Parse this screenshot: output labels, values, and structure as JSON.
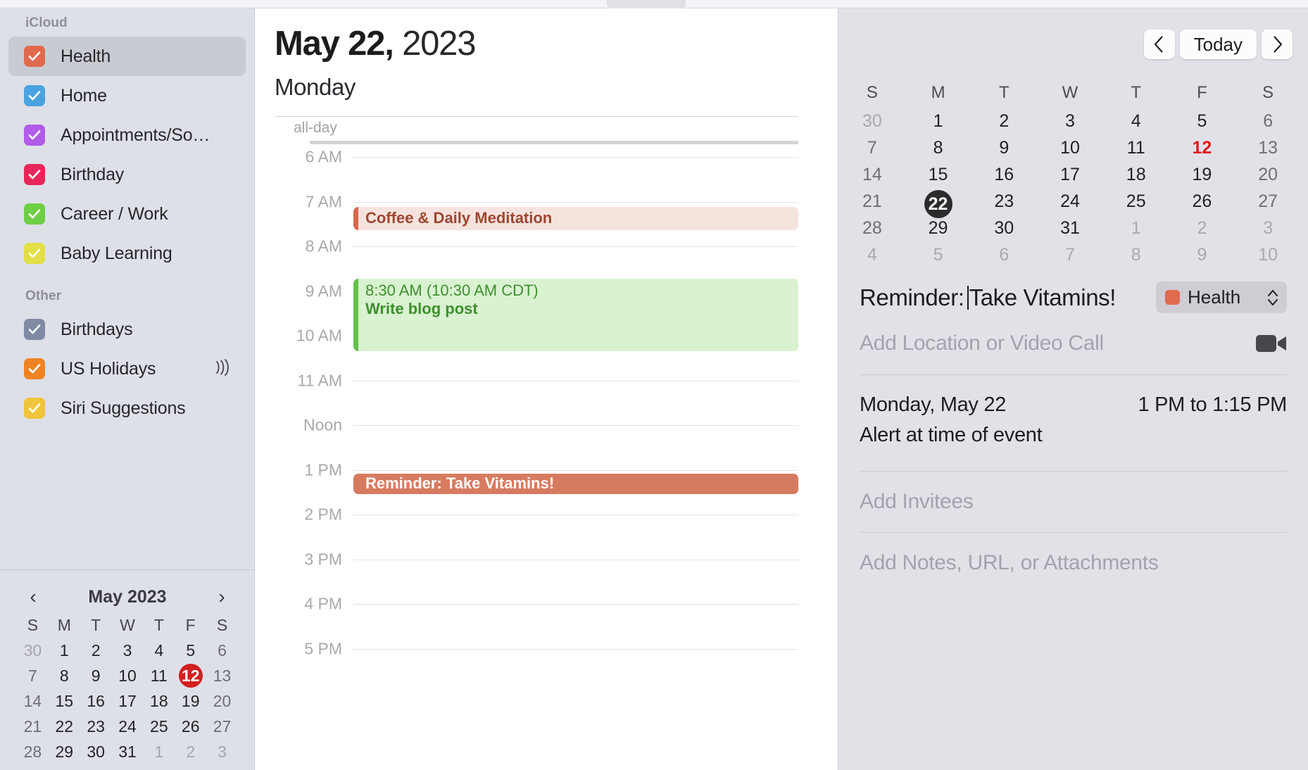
{
  "toolbar": {
    "pill_label": ""
  },
  "sidebar": {
    "sections": [
      {
        "title": "iCloud",
        "items": [
          {
            "label": "Health",
            "color": "#e06a4e",
            "checked": true,
            "selected": true,
            "broadcast": false
          },
          {
            "label": "Home",
            "color": "#4aa3e0",
            "checked": true,
            "selected": false,
            "broadcast": false
          },
          {
            "label": "Appointments/So…",
            "color": "#b05ce8",
            "checked": true,
            "selected": false,
            "broadcast": false
          },
          {
            "label": "Birthday",
            "color": "#e8265a",
            "checked": true,
            "selected": false,
            "broadcast": false
          },
          {
            "label": "Career / Work",
            "color": "#6ece45",
            "checked": true,
            "selected": false,
            "broadcast": false
          },
          {
            "label": "Baby Learning",
            "color": "#e2e046",
            "checked": true,
            "selected": false,
            "broadcast": false
          }
        ]
      },
      {
        "title": "Other",
        "items": [
          {
            "label": "Birthdays",
            "color": "#7f8aa3",
            "checked": true,
            "selected": false,
            "broadcast": false
          },
          {
            "label": "US Holidays",
            "color": "#ef8425",
            "checked": true,
            "selected": false,
            "broadcast": true
          },
          {
            "label": "Siri Suggestions",
            "color": "#f0c43c",
            "checked": true,
            "selected": false,
            "broadcast": false
          }
        ]
      }
    ],
    "mini_calendar": {
      "title": "May 2023",
      "prev_icon": "chevron-left-icon",
      "next_icon": "chevron-right-icon",
      "dow": [
        "S",
        "M",
        "T",
        "W",
        "T",
        "F",
        "S"
      ],
      "weeks": [
        [
          {
            "d": "30",
            "dim": true
          },
          {
            "d": "1"
          },
          {
            "d": "2"
          },
          {
            "d": "3"
          },
          {
            "d": "4"
          },
          {
            "d": "5"
          },
          {
            "d": "6"
          }
        ],
        [
          {
            "d": "7"
          },
          {
            "d": "8"
          },
          {
            "d": "9"
          },
          {
            "d": "10"
          },
          {
            "d": "11"
          },
          {
            "d": "12",
            "today": true
          },
          {
            "d": "13"
          }
        ],
        [
          {
            "d": "14"
          },
          {
            "d": "15"
          },
          {
            "d": "16"
          },
          {
            "d": "17"
          },
          {
            "d": "18"
          },
          {
            "d": "19"
          },
          {
            "d": "20"
          }
        ],
        [
          {
            "d": "21"
          },
          {
            "d": "22"
          },
          {
            "d": "23"
          },
          {
            "d": "24"
          },
          {
            "d": "25"
          },
          {
            "d": "26"
          },
          {
            "d": "27"
          }
        ],
        [
          {
            "d": "28"
          },
          {
            "d": "29"
          },
          {
            "d": "30"
          },
          {
            "d": "31"
          },
          {
            "d": "1",
            "dim": true
          },
          {
            "d": "2",
            "dim": true
          },
          {
            "d": "3",
            "dim": true
          }
        ]
      ]
    }
  },
  "dayview": {
    "month_day": "May 22,",
    "year": "2023",
    "weekday": "Monday",
    "allday_label": "all-day",
    "hours": [
      "6 AM",
      "7 AM",
      "8 AM",
      "9 AM",
      "10 AM",
      "11 AM",
      "Noon",
      "1 PM",
      "2 PM",
      "3 PM",
      "4 PM",
      "5 PM"
    ],
    "events": [
      {
        "title": "Coffee & Daily Meditation",
        "time": "",
        "start_hour_index": 1.12,
        "duration_hours": 0.52,
        "fill": "#f6e3de",
        "bar": "#d9694b",
        "text": "#9e4732",
        "style": "compact"
      },
      {
        "title": "Write blog post",
        "time": "8:30 AM (10:30 AM CDT)",
        "start_hour_index": 2.72,
        "duration_hours": 1.62,
        "fill": "#d9f2d0",
        "bar": "#63c24a",
        "text": "#3f8f2f",
        "style": "full"
      },
      {
        "title": "Reminder: Take Vitamins!",
        "time": "",
        "start_hour_index": 7.08,
        "duration_hours": 0.47,
        "fill": "#d77b60",
        "bar": "#d77b60",
        "text": "#ffffff",
        "style": "compact"
      }
    ]
  },
  "inspector": {
    "nav": {
      "prev_label": "‹",
      "today_label": "Today",
      "next_label": "›"
    },
    "month_calendar": {
      "dow": [
        "S",
        "M",
        "T",
        "W",
        "T",
        "F",
        "S"
      ],
      "weeks": [
        [
          {
            "d": "30",
            "dim": true
          },
          {
            "d": "1"
          },
          {
            "d": "2"
          },
          {
            "d": "3"
          },
          {
            "d": "4"
          },
          {
            "d": "5"
          },
          {
            "d": "6"
          }
        ],
        [
          {
            "d": "7"
          },
          {
            "d": "8"
          },
          {
            "d": "9"
          },
          {
            "d": "10"
          },
          {
            "d": "11"
          },
          {
            "d": "12",
            "today": true
          },
          {
            "d": "13"
          }
        ],
        [
          {
            "d": "14"
          },
          {
            "d": "15"
          },
          {
            "d": "16"
          },
          {
            "d": "17"
          },
          {
            "d": "18"
          },
          {
            "d": "19"
          },
          {
            "d": "20"
          }
        ],
        [
          {
            "d": "21"
          },
          {
            "d": "22",
            "selected": true
          },
          {
            "d": "23"
          },
          {
            "d": "24"
          },
          {
            "d": "25"
          },
          {
            "d": "26"
          },
          {
            "d": "27"
          }
        ],
        [
          {
            "d": "28"
          },
          {
            "d": "29"
          },
          {
            "d": "30"
          },
          {
            "d": "31"
          },
          {
            "d": "1",
            "dim": true
          },
          {
            "d": "2",
            "dim": true
          },
          {
            "d": "3",
            "dim": true
          }
        ],
        [
          {
            "d": "4",
            "dim": true
          },
          {
            "d": "5",
            "dim": true
          },
          {
            "d": "6",
            "dim": true
          },
          {
            "d": "7",
            "dim": true
          },
          {
            "d": "8",
            "dim": true
          },
          {
            "d": "9",
            "dim": true
          },
          {
            "d": "10",
            "dim": true
          }
        ]
      ]
    },
    "event": {
      "title_prefix": "Reminder:",
      "title_suffix": "Take Vitamins!",
      "calendar_name": "Health",
      "calendar_color": "#e06a4e",
      "location_placeholder": "Add Location or Video Call",
      "date_text": "Monday, May 22",
      "time_text": "1 PM to 1:15 PM",
      "alert_text": "Alert at time of event",
      "invitees_placeholder": "Add Invitees",
      "notes_placeholder": "Add Notes, URL, or Attachments"
    }
  }
}
